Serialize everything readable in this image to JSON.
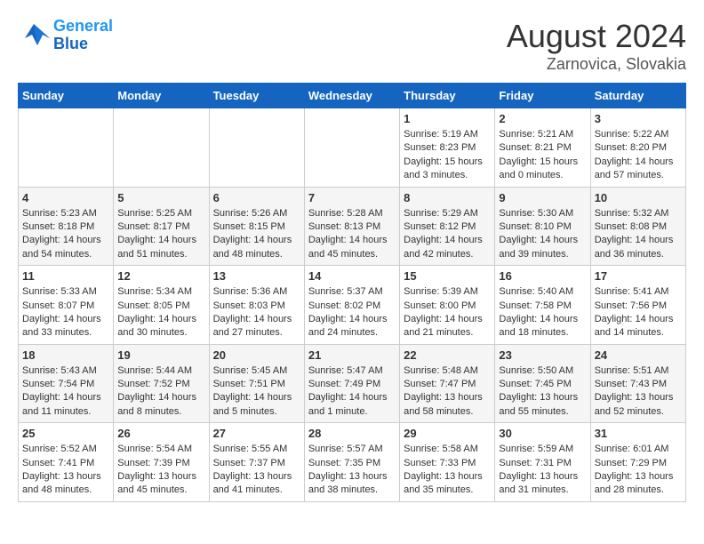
{
  "header": {
    "logo_line1": "General",
    "logo_line2": "Blue",
    "title": "August 2024",
    "subtitle": "Zarnovica, Slovakia"
  },
  "weekdays": [
    "Sunday",
    "Monday",
    "Tuesday",
    "Wednesday",
    "Thursday",
    "Friday",
    "Saturday"
  ],
  "weeks": [
    [
      {
        "day": "",
        "info": ""
      },
      {
        "day": "",
        "info": ""
      },
      {
        "day": "",
        "info": ""
      },
      {
        "day": "",
        "info": ""
      },
      {
        "day": "1",
        "info": "Sunrise: 5:19 AM\nSunset: 8:23 PM\nDaylight: 15 hours\nand 3 minutes."
      },
      {
        "day": "2",
        "info": "Sunrise: 5:21 AM\nSunset: 8:21 PM\nDaylight: 15 hours\nand 0 minutes."
      },
      {
        "day": "3",
        "info": "Sunrise: 5:22 AM\nSunset: 8:20 PM\nDaylight: 14 hours\nand 57 minutes."
      }
    ],
    [
      {
        "day": "4",
        "info": "Sunrise: 5:23 AM\nSunset: 8:18 PM\nDaylight: 14 hours\nand 54 minutes."
      },
      {
        "day": "5",
        "info": "Sunrise: 5:25 AM\nSunset: 8:17 PM\nDaylight: 14 hours\nand 51 minutes."
      },
      {
        "day": "6",
        "info": "Sunrise: 5:26 AM\nSunset: 8:15 PM\nDaylight: 14 hours\nand 48 minutes."
      },
      {
        "day": "7",
        "info": "Sunrise: 5:28 AM\nSunset: 8:13 PM\nDaylight: 14 hours\nand 45 minutes."
      },
      {
        "day": "8",
        "info": "Sunrise: 5:29 AM\nSunset: 8:12 PM\nDaylight: 14 hours\nand 42 minutes."
      },
      {
        "day": "9",
        "info": "Sunrise: 5:30 AM\nSunset: 8:10 PM\nDaylight: 14 hours\nand 39 minutes."
      },
      {
        "day": "10",
        "info": "Sunrise: 5:32 AM\nSunset: 8:08 PM\nDaylight: 14 hours\nand 36 minutes."
      }
    ],
    [
      {
        "day": "11",
        "info": "Sunrise: 5:33 AM\nSunset: 8:07 PM\nDaylight: 14 hours\nand 33 minutes."
      },
      {
        "day": "12",
        "info": "Sunrise: 5:34 AM\nSunset: 8:05 PM\nDaylight: 14 hours\nand 30 minutes."
      },
      {
        "day": "13",
        "info": "Sunrise: 5:36 AM\nSunset: 8:03 PM\nDaylight: 14 hours\nand 27 minutes."
      },
      {
        "day": "14",
        "info": "Sunrise: 5:37 AM\nSunset: 8:02 PM\nDaylight: 14 hours\nand 24 minutes."
      },
      {
        "day": "15",
        "info": "Sunrise: 5:39 AM\nSunset: 8:00 PM\nDaylight: 14 hours\nand 21 minutes."
      },
      {
        "day": "16",
        "info": "Sunrise: 5:40 AM\nSunset: 7:58 PM\nDaylight: 14 hours\nand 18 minutes."
      },
      {
        "day": "17",
        "info": "Sunrise: 5:41 AM\nSunset: 7:56 PM\nDaylight: 14 hours\nand 14 minutes."
      }
    ],
    [
      {
        "day": "18",
        "info": "Sunrise: 5:43 AM\nSunset: 7:54 PM\nDaylight: 14 hours\nand 11 minutes."
      },
      {
        "day": "19",
        "info": "Sunrise: 5:44 AM\nSunset: 7:52 PM\nDaylight: 14 hours\nand 8 minutes."
      },
      {
        "day": "20",
        "info": "Sunrise: 5:45 AM\nSunset: 7:51 PM\nDaylight: 14 hours\nand 5 minutes."
      },
      {
        "day": "21",
        "info": "Sunrise: 5:47 AM\nSunset: 7:49 PM\nDaylight: 14 hours\nand 1 minute."
      },
      {
        "day": "22",
        "info": "Sunrise: 5:48 AM\nSunset: 7:47 PM\nDaylight: 13 hours\nand 58 minutes."
      },
      {
        "day": "23",
        "info": "Sunrise: 5:50 AM\nSunset: 7:45 PM\nDaylight: 13 hours\nand 55 minutes."
      },
      {
        "day": "24",
        "info": "Sunrise: 5:51 AM\nSunset: 7:43 PM\nDaylight: 13 hours\nand 52 minutes."
      }
    ],
    [
      {
        "day": "25",
        "info": "Sunrise: 5:52 AM\nSunset: 7:41 PM\nDaylight: 13 hours\nand 48 minutes."
      },
      {
        "day": "26",
        "info": "Sunrise: 5:54 AM\nSunset: 7:39 PM\nDaylight: 13 hours\nand 45 minutes."
      },
      {
        "day": "27",
        "info": "Sunrise: 5:55 AM\nSunset: 7:37 PM\nDaylight: 13 hours\nand 41 minutes."
      },
      {
        "day": "28",
        "info": "Sunrise: 5:57 AM\nSunset: 7:35 PM\nDaylight: 13 hours\nand 38 minutes."
      },
      {
        "day": "29",
        "info": "Sunrise: 5:58 AM\nSunset: 7:33 PM\nDaylight: 13 hours\nand 35 minutes."
      },
      {
        "day": "30",
        "info": "Sunrise: 5:59 AM\nSunset: 7:31 PM\nDaylight: 13 hours\nand 31 minutes."
      },
      {
        "day": "31",
        "info": "Sunrise: 6:01 AM\nSunset: 7:29 PM\nDaylight: 13 hours\nand 28 minutes."
      }
    ]
  ]
}
